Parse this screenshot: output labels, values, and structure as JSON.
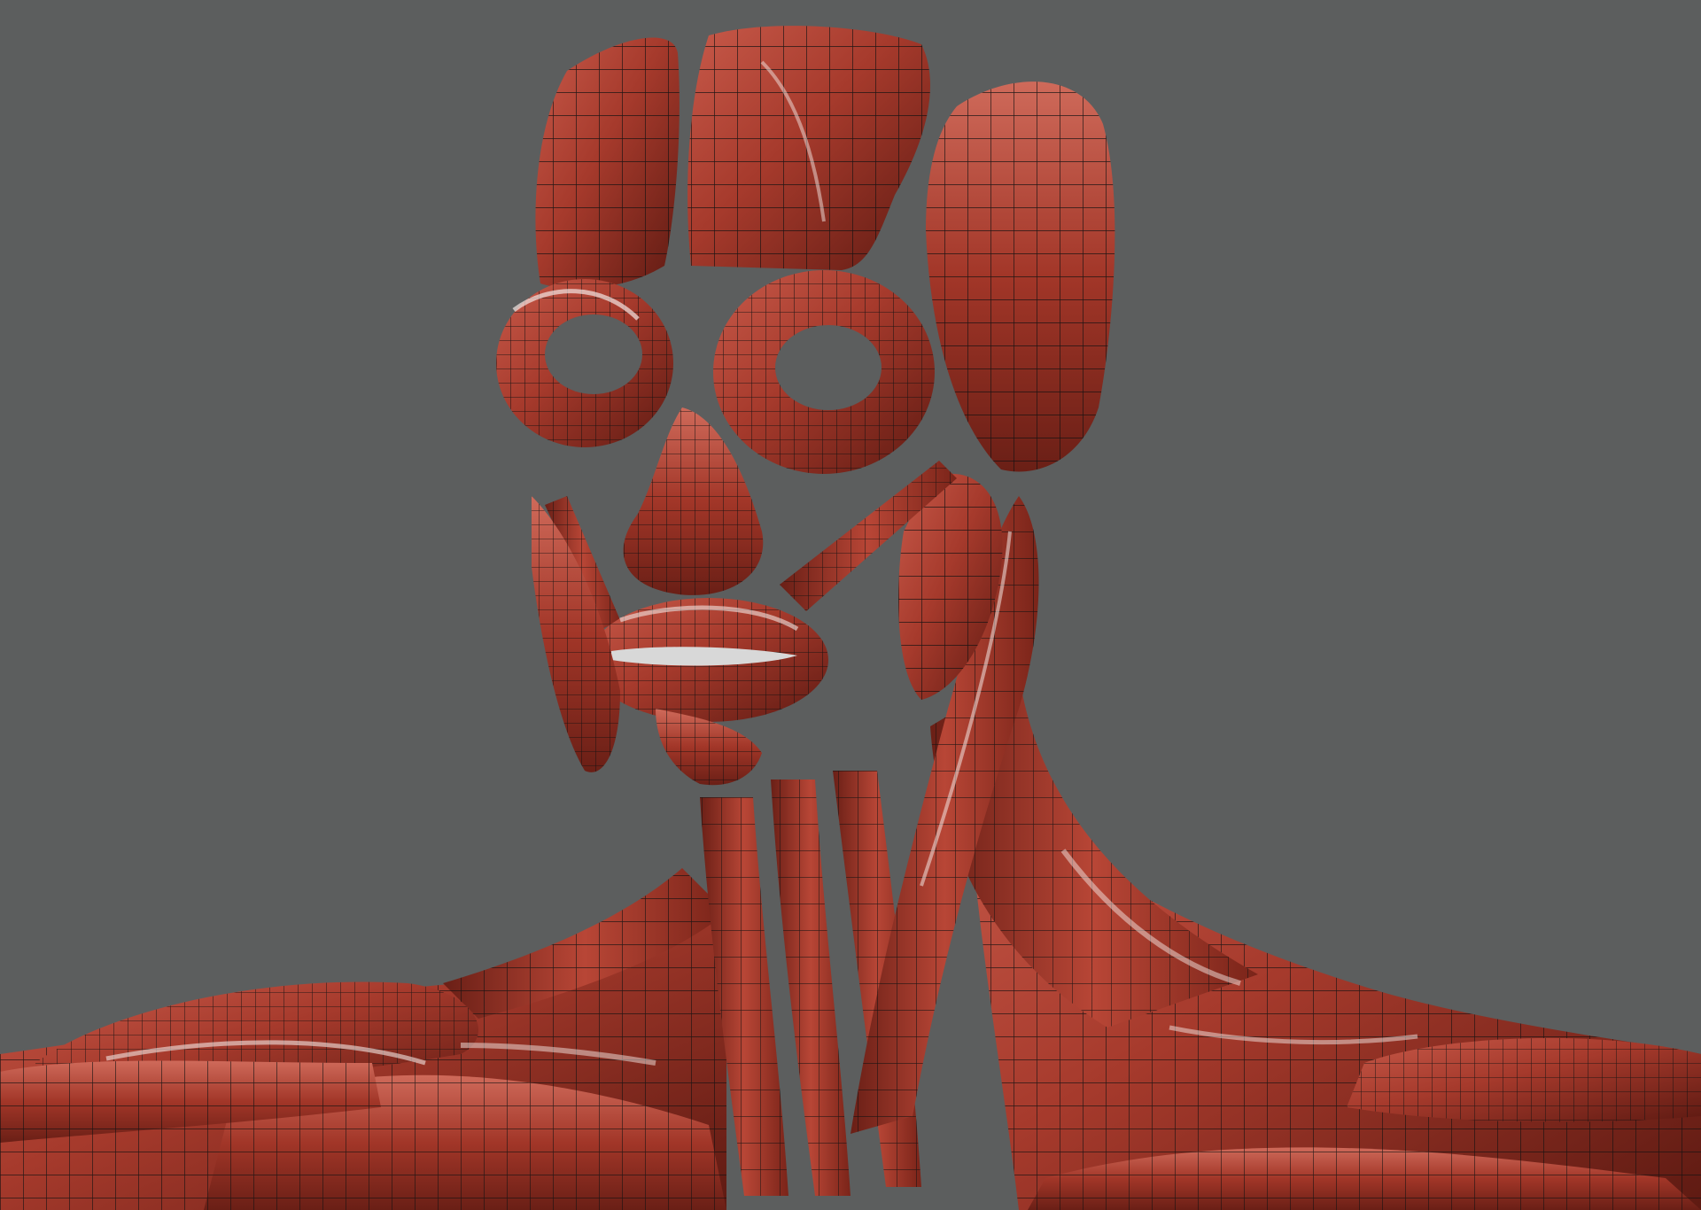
{
  "scene": {
    "subject": "muscle-anatomy-head-neck",
    "background_color": "#5c5e5e",
    "muscle_color": "#a63a2c",
    "muscle_highlight": "#d8786a",
    "muscle_shadow": "#5e1a12",
    "wire_color": "#111111",
    "specular_color": "#f2e6e2"
  }
}
